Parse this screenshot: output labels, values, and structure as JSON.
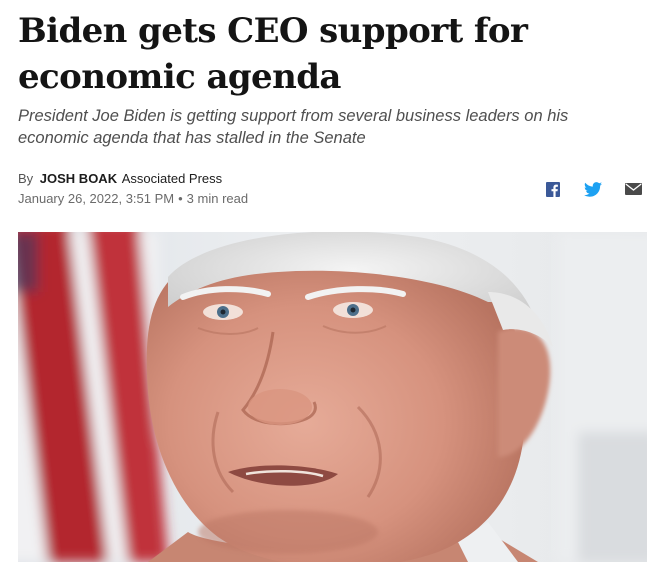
{
  "article": {
    "headline": "Biden gets CEO support for economic agenda",
    "dek": "President Joe Biden is getting support from several business leaders on his economic agenda that has stalled in the Senate",
    "byline": {
      "by": "By",
      "author": "JOSH BOAK",
      "outlet": "Associated Press"
    },
    "date": "January 26, 2022, 3:51 PM",
    "separator": "•",
    "read_time": "3 min read"
  },
  "share": {
    "icons": [
      "facebook-icon",
      "twitter-icon",
      "email-icon"
    ],
    "colors": {
      "facebook": "#3b5998",
      "twitter": "#1da1f2",
      "email": "#4a4a4a"
    }
  },
  "hero_image": {
    "subject": "close-up portrait photo",
    "colors": {
      "flag_red": "#b3262d",
      "background": "#e9ecef",
      "hair": "#e6e6e6",
      "skin": "#d89a86"
    }
  }
}
